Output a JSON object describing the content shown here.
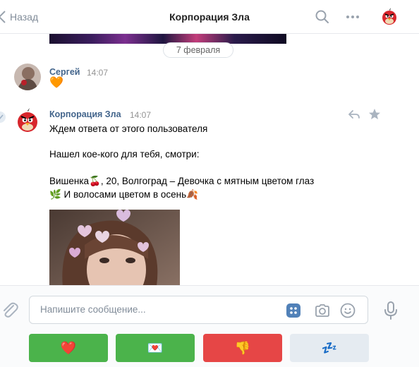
{
  "header": {
    "back_label": "Назад",
    "title": "Корпорация Зла",
    "icons": [
      "chevron-left-icon",
      "search-icon",
      "more-icon",
      "angry-bird-avatar"
    ]
  },
  "chat": {
    "date_separator": "7 февраля",
    "messages": [
      {
        "author": "Сергей",
        "time": "14:07",
        "lines": [
          "🧡"
        ]
      },
      {
        "author": "Корпорация Зла",
        "time": "14:07",
        "lines": [
          "Ждем ответа от этого пользователя",
          "",
          "Нашел кое-кого для тебя, смотри:",
          "",
          "Вишенка🍒, 20, Волгоград – Девочка с мятным цветом глаз",
          "🌿 И волосами цветом в осень🍂"
        ],
        "actions": [
          "reply-icon",
          "star-icon"
        ]
      }
    ]
  },
  "composer": {
    "placeholder": "Напишите сообщение...",
    "icons": [
      "paperclip-icon",
      "keyboard-grid-icon",
      "camera-icon",
      "smile-icon",
      "microphone-icon"
    ]
  },
  "keyboard": {
    "buttons": [
      {
        "label": "❤️",
        "color": "#4bb34b"
      },
      {
        "label": "💌",
        "color": "#4bb34b"
      },
      {
        "label": "👎",
        "color": "#e64646"
      },
      {
        "label": "💤",
        "color": "#e5ebf1"
      }
    ]
  },
  "colors": {
    "accent": "#42648b",
    "positive": "#4bb34b",
    "negative": "#e64646",
    "secondary": "#e5ebf1"
  }
}
